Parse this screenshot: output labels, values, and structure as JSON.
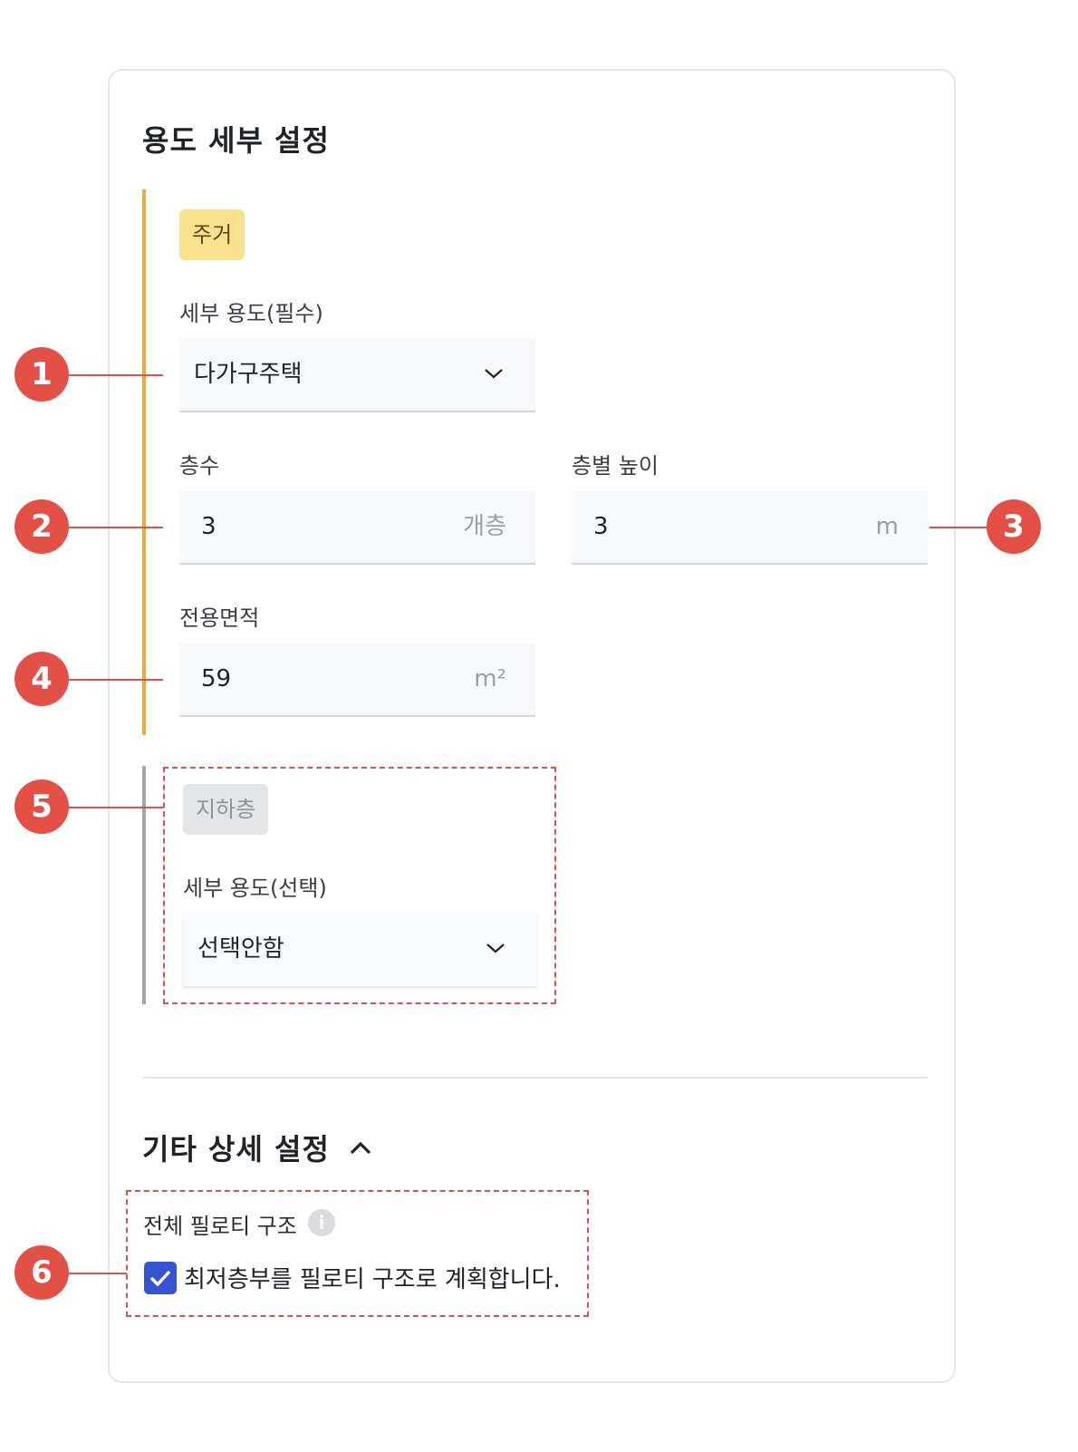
{
  "usage_detail": {
    "title": "용도 세부 설정",
    "residential": {
      "tag": "주거",
      "sub_use_label": "세부 용도(필수)",
      "sub_use_value": "다가구주택",
      "floors_label": "층수",
      "floors_value": "3",
      "floors_unit": "개층",
      "floor_height_label": "층별 높이",
      "floor_height_value": "3",
      "floor_height_unit": "m",
      "area_label": "전용면적",
      "area_value": "59",
      "area_unit": "m²"
    },
    "basement": {
      "tag": "지하층",
      "sub_use_label": "세부 용도(선택)",
      "sub_use_value": "선택안함"
    }
  },
  "other_settings": {
    "title": "기타 상세 설정",
    "piloti_label": "전체 필로티 구조",
    "piloti_checkbox_label": "최저층부를 필로티 구조로 계획합니다.",
    "piloti_checked": true
  },
  "markers": [
    "1",
    "2",
    "3",
    "4",
    "5",
    "6"
  ],
  "colors": {
    "residential_bar": "#f0a93a",
    "residential_tag_bg": "#f9e28e",
    "basement_bar": "#a3a6aa",
    "basement_tag_bg": "#e3e5e8",
    "marker": "#e35146",
    "checkbox": "#3554d1"
  },
  "icons": [
    "chevron-down-icon",
    "chevron-up-icon",
    "info-icon",
    "check-icon"
  ]
}
